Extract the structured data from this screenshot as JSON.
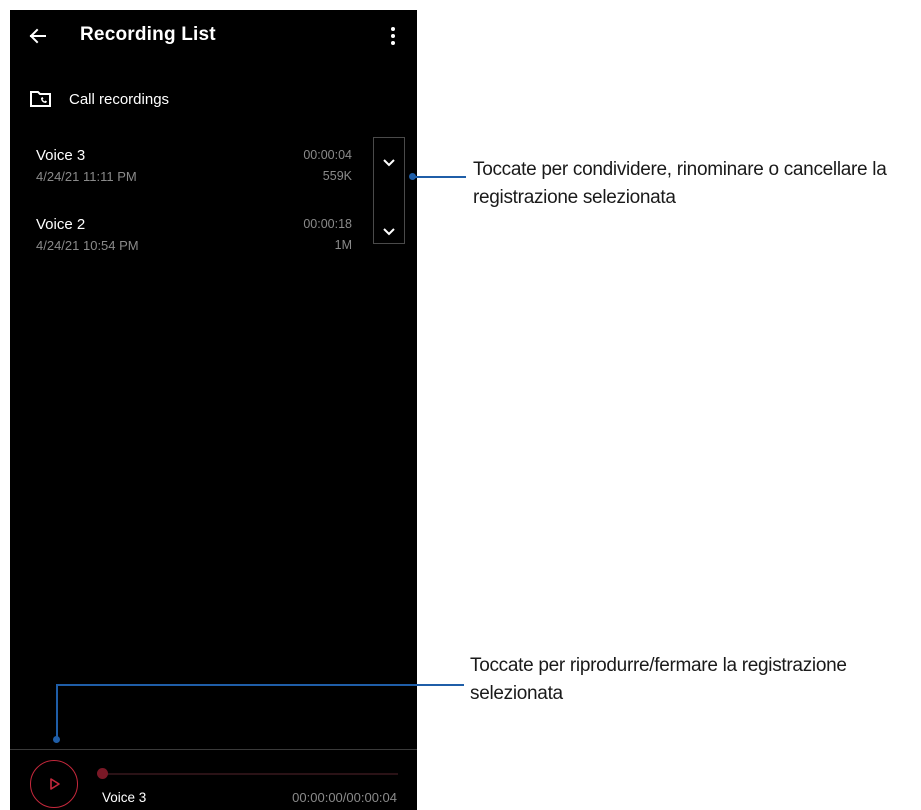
{
  "appbar": {
    "title": "Recording List",
    "back_icon": "arrow-left-icon",
    "menu_icon": "more-vertical-icon"
  },
  "call_recordings": {
    "label": "Call recordings",
    "icon": "folder-phone-icon"
  },
  "recordings": [
    {
      "name": "Voice 3",
      "date": "4/24/21 11:11 PM",
      "duration": "00:00:04",
      "size": "559K"
    },
    {
      "name": "Voice 2",
      "date": "4/24/21 10:54 PM",
      "duration": "00:00:18",
      "size": "1M"
    }
  ],
  "player": {
    "track_name": "Voice 3",
    "time": "00:00:00/00:00:04",
    "progress": 0,
    "accent_color": "#c6283c"
  },
  "callouts": {
    "expand_line1": "Toccate per condividere, rinominare o cancellare la",
    "expand_line2": "registrazione selezionata",
    "play_line1": "Toccate per riprodurre/fermare la registrazione",
    "play_line2": "selezionata",
    "line_color": "#1f5ea8"
  }
}
